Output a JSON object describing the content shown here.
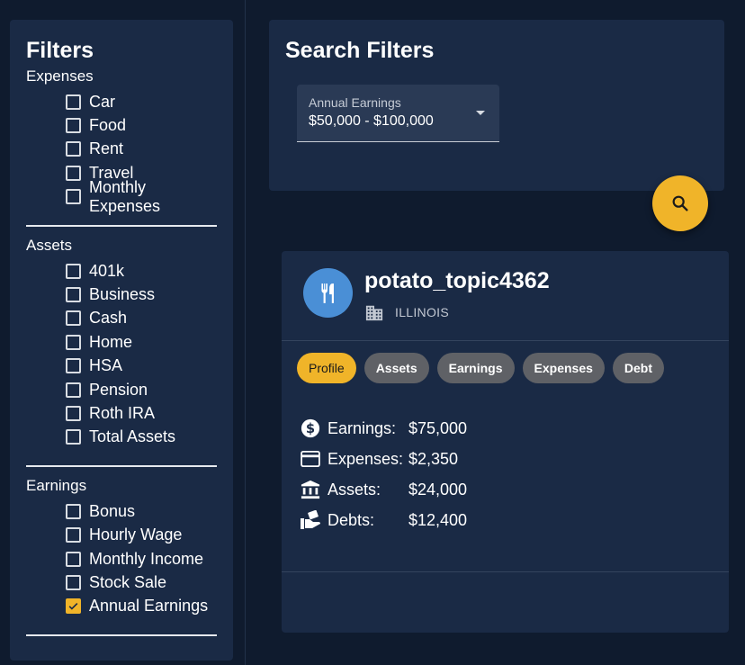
{
  "filters": {
    "title": "Filters",
    "sections": [
      {
        "title": "Expenses",
        "items": [
          {
            "label": "Car",
            "checked": false
          },
          {
            "label": "Food",
            "checked": false
          },
          {
            "label": "Rent",
            "checked": false
          },
          {
            "label": "Travel",
            "checked": false
          },
          {
            "label": "Monthly Expenses",
            "checked": false
          }
        ]
      },
      {
        "title": "Assets",
        "items": [
          {
            "label": "401k",
            "checked": false
          },
          {
            "label": "Business",
            "checked": false
          },
          {
            "label": "Cash",
            "checked": false
          },
          {
            "label": "Home",
            "checked": false
          },
          {
            "label": "HSA",
            "checked": false
          },
          {
            "label": "Pension",
            "checked": false
          },
          {
            "label": "Roth IRA",
            "checked": false
          },
          {
            "label": "Total Assets",
            "checked": false
          }
        ]
      },
      {
        "title": "Earnings",
        "items": [
          {
            "label": "Bonus",
            "checked": false
          },
          {
            "label": "Hourly Wage",
            "checked": false
          },
          {
            "label": "Monthly Income",
            "checked": false
          },
          {
            "label": "Stock Sale",
            "checked": false
          },
          {
            "label": "Annual Earnings",
            "checked": true
          }
        ]
      }
    ]
  },
  "search": {
    "title": "Search Filters",
    "select": {
      "label": "Annual Earnings",
      "value": "$50,000 - $100,000"
    },
    "button_icon": "search-icon"
  },
  "profile": {
    "username": "potato_topic4362",
    "location": "ILLINOIS",
    "avatar_icon": "restaurant-icon",
    "tabs": [
      "Profile",
      "Assets",
      "Earnings",
      "Expenses",
      "Debt"
    ],
    "active_tab": "Profile",
    "stats": [
      {
        "icon": "dollar-icon",
        "label": "Earnings:",
        "value": "$75,000"
      },
      {
        "icon": "credit-card-icon",
        "label": "Expenses:",
        "value": "$2,350"
      },
      {
        "icon": "bank-icon",
        "label": "Assets:",
        "value": "$24,000"
      },
      {
        "icon": "debt-hand-icon",
        "label": "Debts:",
        "value": "$12,400"
      }
    ]
  },
  "colors": {
    "accent": "#f0b429",
    "panel": "#1a2a45",
    "background": "#0f1b2e",
    "avatar": "#4a8fd6"
  }
}
